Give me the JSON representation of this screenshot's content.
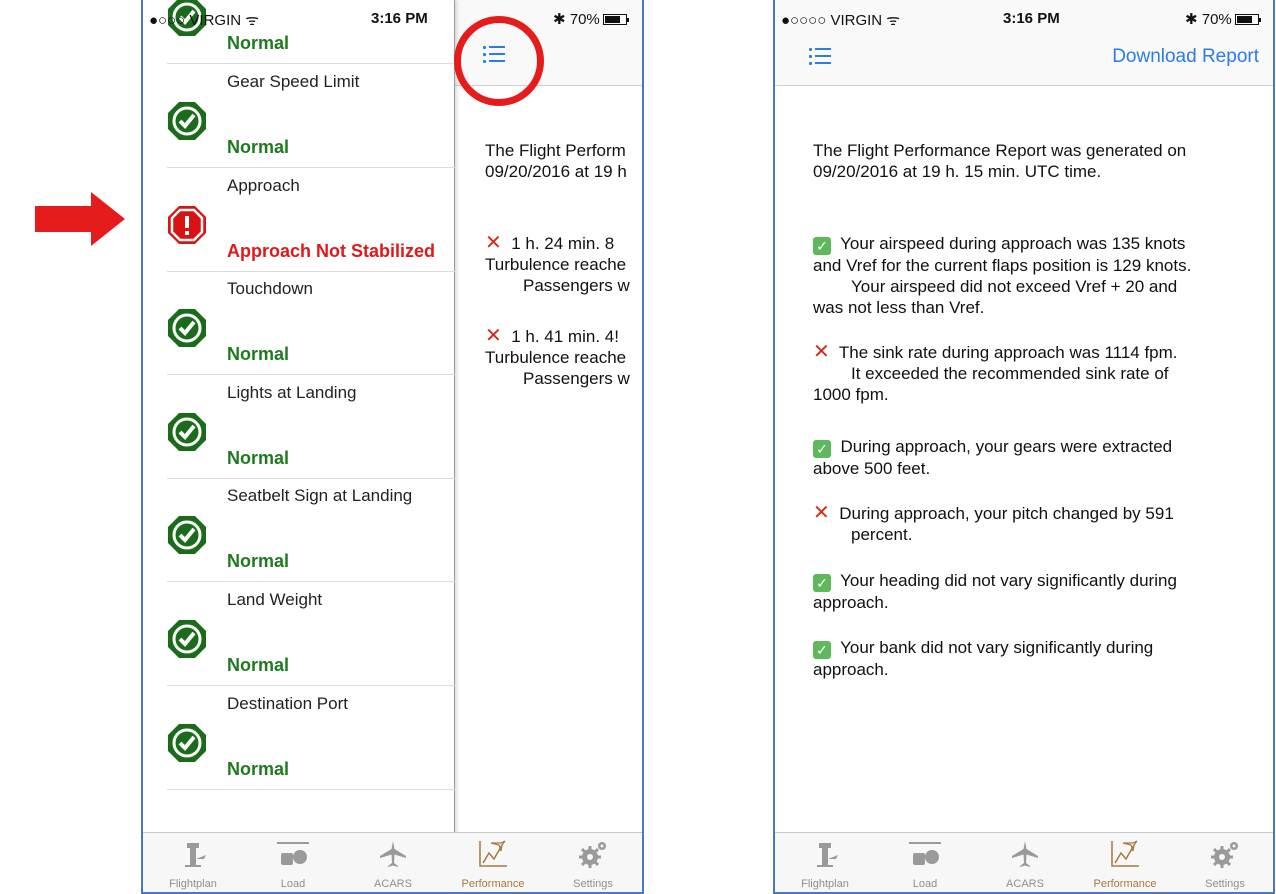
{
  "status_bar": {
    "carrier": "●○○○○ VIRGIN ᯤ",
    "carrier_left": "●○○○ VIRGIN ᯤ",
    "time": "3:16 PM",
    "battery": "✱ 70%"
  },
  "drawer": {
    "top_partial_status": "Normal",
    "items": [
      {
        "title": "Gear Speed Limit",
        "status": "Normal",
        "state": "ok"
      },
      {
        "title": "Approach",
        "status": "Approach Not Stabilized",
        "state": "bad"
      },
      {
        "title": "Touchdown",
        "status": "Normal",
        "state": "ok"
      },
      {
        "title": "Lights at Landing",
        "status": "Normal",
        "state": "ok"
      },
      {
        "title": "Seatbelt Sign at Landing",
        "status": "Normal",
        "state": "ok"
      },
      {
        "title": "Land Weight",
        "status": "Normal",
        "state": "ok"
      },
      {
        "title": "Destination Port",
        "status": "Normal",
        "state": "ok"
      }
    ]
  },
  "left_content": {
    "intro_line1": "The Flight Perform",
    "intro_line2": "09/20/2016 at 19 h",
    "events": [
      {
        "line1": "1 h. 24 min. 8",
        "line2": "Turbulence reache",
        "line3": "Passengers w"
      },
      {
        "line1": "1 h. 41 min. 4!",
        "line2": "Turbulence reache",
        "line3": "Passengers w"
      }
    ]
  },
  "right": {
    "nav_action": "Download Report",
    "intro": "The Flight Performance Report was generated on 09/20/2016 at 19 h. 15 min. UTC time.",
    "items": [
      {
        "mark": "check",
        "lines": [
          "Your airspeed during approach was 135 knots",
          "and Vref for the current flaps position is 129 knots.",
          "Your airspeed did not exceed Vref + 20 and",
          "was not less than Vref."
        ]
      },
      {
        "mark": "x",
        "lines": [
          "The sink rate during approach was 1114 fpm.",
          "It exceeded the recommended sink rate of",
          "1000 fpm."
        ]
      },
      {
        "mark": "check",
        "lines": [
          "During approach, your gears were extracted",
          "above 500 feet."
        ]
      },
      {
        "mark": "x",
        "lines": [
          "During approach, your pitch changed by 591",
          "percent."
        ]
      },
      {
        "mark": "check",
        "lines": [
          "Your heading did not vary significantly during",
          "approach."
        ]
      },
      {
        "mark": "check",
        "lines": [
          "Your bank did not vary significantly during",
          "approach."
        ]
      }
    ]
  },
  "tabs": [
    {
      "label": "Flightplan",
      "icon": "tower-icon"
    },
    {
      "label": "Load",
      "icon": "luggage-icon"
    },
    {
      "label": "ACARS",
      "icon": "airplane-icon"
    },
    {
      "label": "Performance",
      "icon": "performance-chart-icon",
      "active": true
    },
    {
      "label": "Settings",
      "icon": "gear-icon"
    }
  ],
  "colors": {
    "ok": "#1f7a1f",
    "bad": "#e0181a",
    "accent": "#2a7ce6",
    "active_tab": "#a6793a",
    "annotation": "#e61b1b"
  }
}
